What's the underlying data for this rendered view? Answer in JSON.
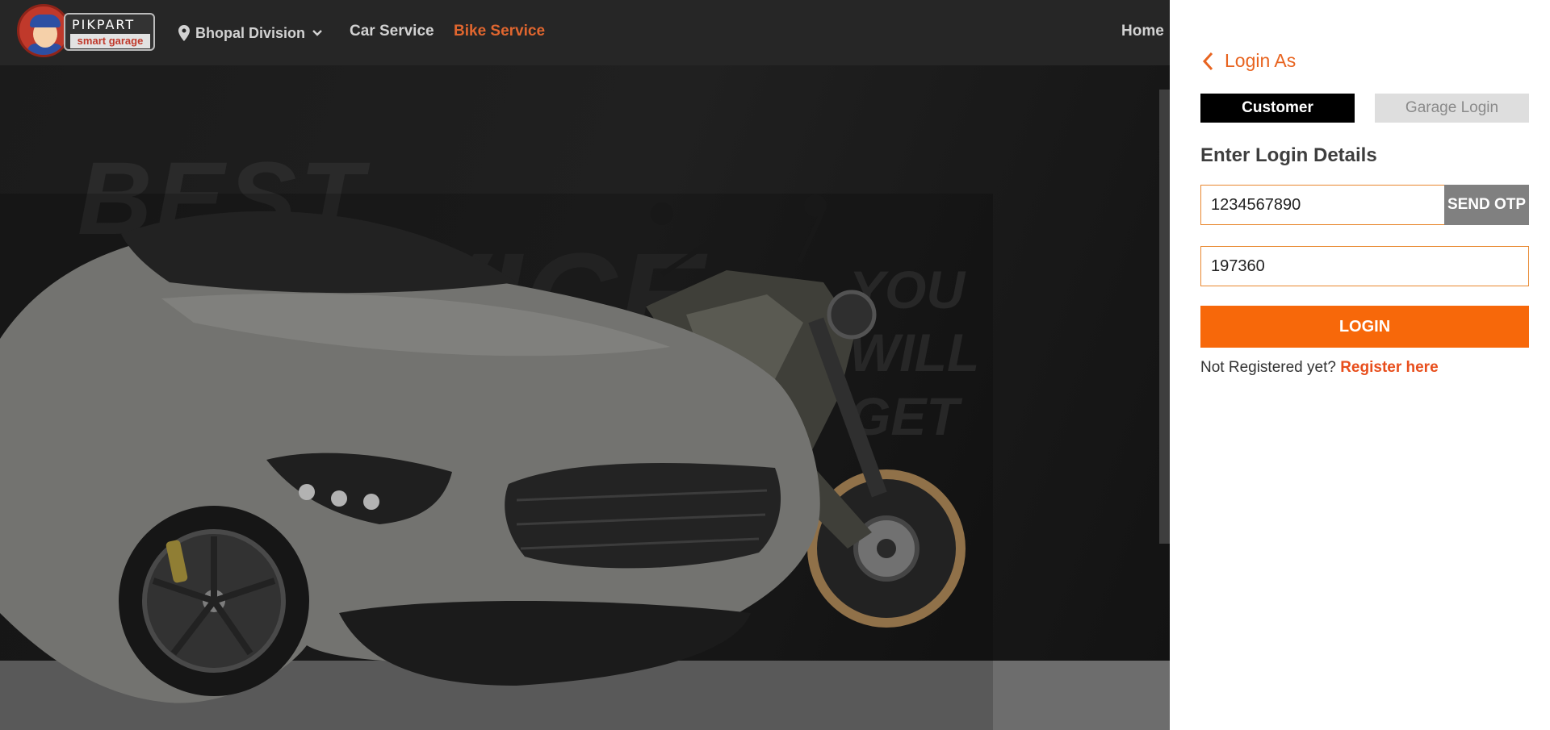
{
  "header": {
    "brand": "PIKPART",
    "brand_sub": "smart garage",
    "location": "Bhopal Division",
    "nav": {
      "car_service": "Car Service",
      "bike_service": "Bike Service",
      "home": "Home"
    }
  },
  "hero": {
    "tagline": {
      "line1": "BEST",
      "line2": "SERVICE",
      "line3": "YOU",
      "line4": "WILL",
      "line5": "GET"
    }
  },
  "login_panel": {
    "back_label": "Login As",
    "tabs": {
      "customer": "Customer",
      "garage": "Garage Login"
    },
    "title": "Enter Login Details",
    "phone": {
      "value": "1234567890"
    },
    "otp": {
      "value": "197360"
    },
    "send_otp_label": "SEND OTP",
    "login_label": "LOGIN",
    "register_prompt": "Not Registered yet?",
    "register_link": "Register here"
  },
  "colors": {
    "accent": "#f7680a",
    "active_link": "#e0662f",
    "header_bg": "#262626",
    "input_border": "#e8872e"
  }
}
